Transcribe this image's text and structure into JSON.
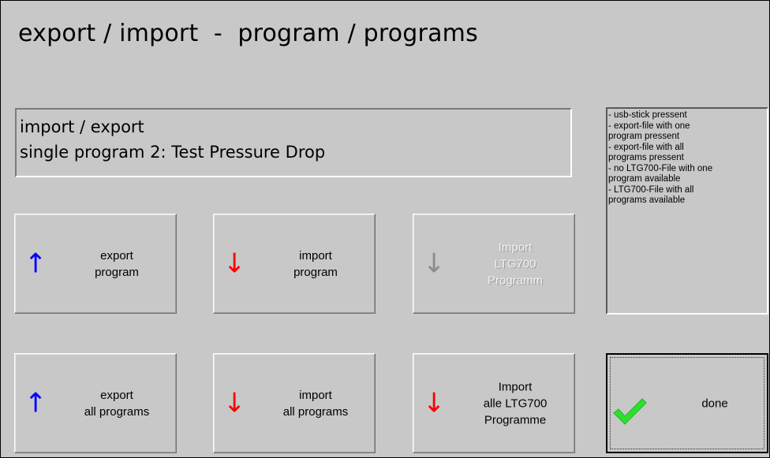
{
  "page": {
    "title": "export / import  -  program / programs"
  },
  "info_box": {
    "line1": "import / export",
    "line2": "single program 2: Test Pressure Drop"
  },
  "status_box": {
    "lines": [
      "- usb-stick pressent",
      "- export-file with one",
      "program pressent",
      "- export-file with all",
      "programs pressent",
      "- no LTG700-File with one",
      "program available",
      "- LTG700-File with all",
      "programs available"
    ]
  },
  "buttons": {
    "export_program": {
      "line1": "export",
      "line2": "program",
      "icon": "arrow-up-icon",
      "color": "#0000ff"
    },
    "import_program": {
      "line1": "import",
      "line2": "program",
      "icon": "arrow-down-icon",
      "color": "#ff0000"
    },
    "import_ltg700_program": {
      "line1": "Import",
      "line2": "LTG700",
      "line3": "Programm",
      "icon": "arrow-down-icon",
      "color": "#8c8c8c",
      "disabled": true
    },
    "export_all": {
      "line1": "export",
      "line2": "all programs",
      "icon": "arrow-up-icon",
      "color": "#0000ff"
    },
    "import_all": {
      "line1": "import",
      "line2": "all programs",
      "icon": "arrow-down-icon",
      "color": "#ff0000"
    },
    "import_all_ltg700": {
      "line1": "Import",
      "line2": "alle LTG700",
      "line3": "Programme",
      "icon": "arrow-down-icon",
      "color": "#ff0000"
    },
    "done": {
      "label": "done",
      "icon": "checkmark-icon",
      "color": "#22dd22"
    }
  },
  "icons": {
    "arrow_up": "↑",
    "arrow_down": "↓"
  }
}
